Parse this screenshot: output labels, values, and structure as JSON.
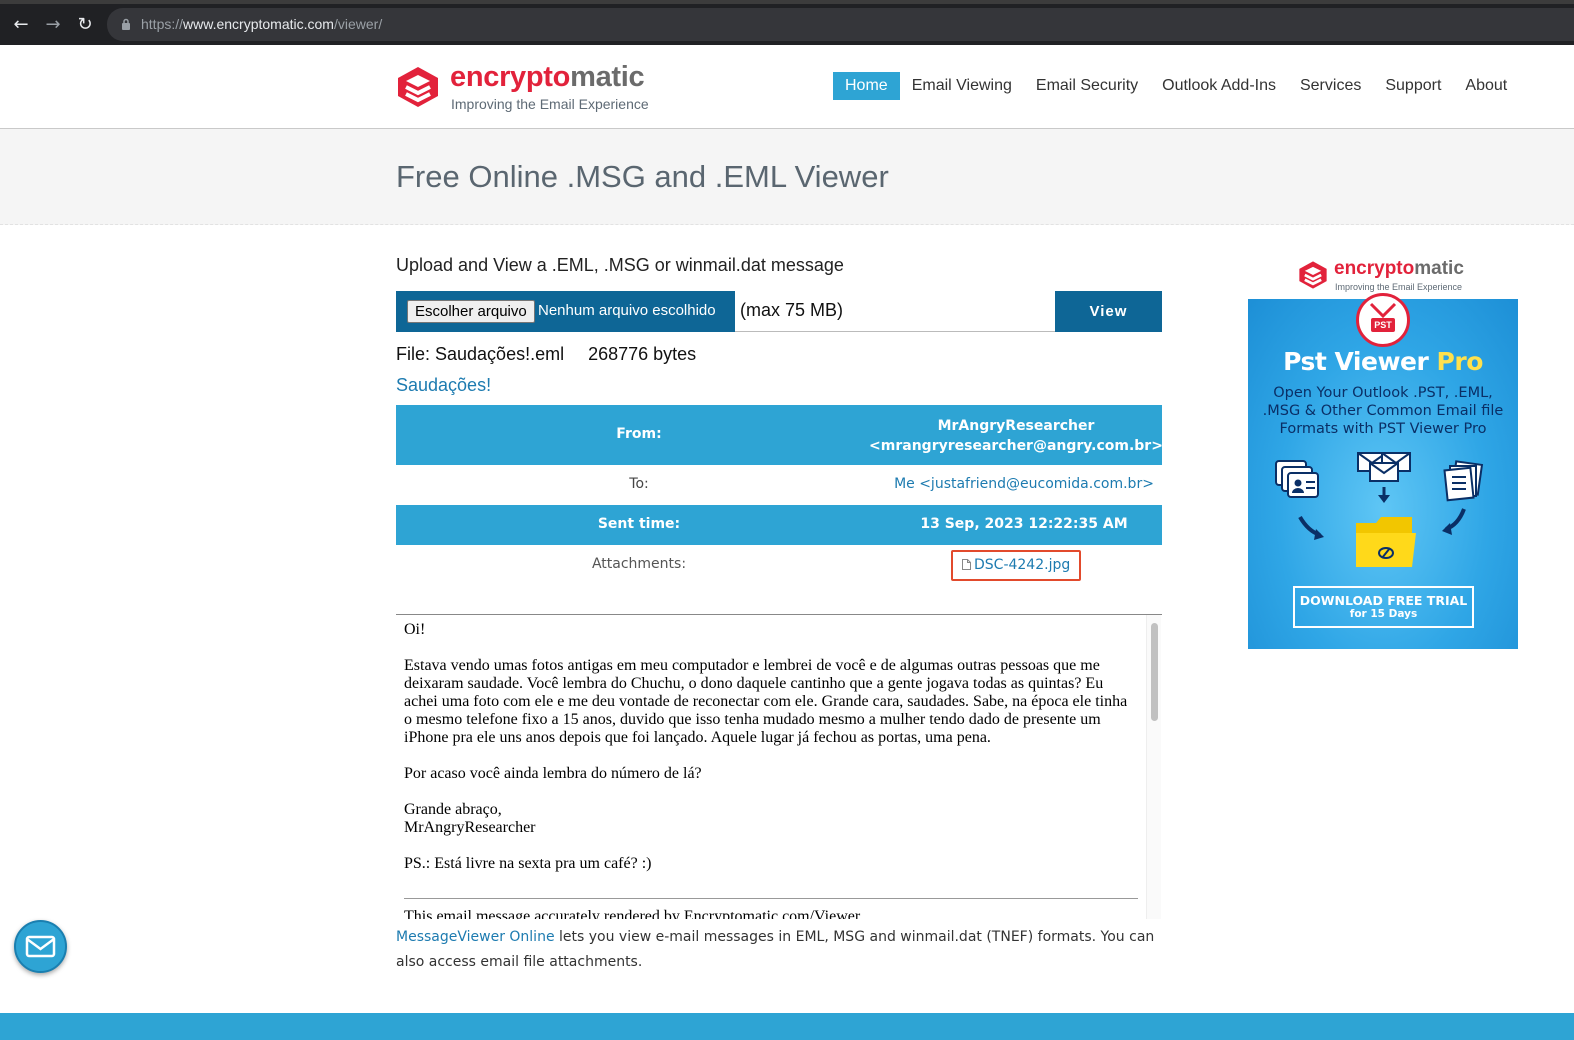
{
  "browser": {
    "url_scheme": "https://",
    "url_host": "www.encryptomatic.com",
    "url_path": "/viewer/",
    "back_icon": "back-arrow-icon",
    "forward_icon": "forward-arrow-icon",
    "reload_icon": "reload-icon",
    "lock_icon": "lock-icon"
  },
  "brand": {
    "name_red": "encrypto",
    "name_gray": "matic",
    "tagline": "Improving the Email Experience",
    "red": "#e2223b",
    "accent": "#2ea4d4",
    "dark_blue": "#0e6696"
  },
  "nav": {
    "items": [
      {
        "label": "Home",
        "active": true
      },
      {
        "label": "Email Viewing",
        "active": false
      },
      {
        "label": "Email Security",
        "active": false
      },
      {
        "label": "Outlook Add-Ins",
        "active": false
      },
      {
        "label": "Services",
        "active": false
      },
      {
        "label": "Support",
        "active": false
      },
      {
        "label": "About",
        "active": false
      }
    ]
  },
  "page": {
    "title": "Free Online .MSG and .EML Viewer"
  },
  "upload": {
    "heading": "Upload and View a .EML, .MSG or winmail.dat message",
    "choose_label": "Escolher arquivo",
    "no_file_label": "Nenhum arquivo escolhido",
    "max_size": "(max 75 MB)",
    "view_label": "View"
  },
  "file": {
    "name": "File: Saudações!.eml",
    "size": "268776 bytes"
  },
  "message": {
    "subject": "Saudações!",
    "from_label": "From:",
    "from_name": "MrAngryResearcher",
    "from_email": "<mrangryresearcher@angry.com.br>",
    "to_label": "To:",
    "to_value": "Me <justafriend@eucomida.com.br>",
    "sent_label": "Sent time:",
    "sent_value": "13 Sep, 2023 12:22:35 AM",
    "attachments_label": "Attachments:",
    "attachment_name": "DSC-4242.jpg",
    "attachment_icon": "file-icon",
    "body": {
      "greeting": "Oi!",
      "paragraph1": "Estava vendo umas fotos antigas em meu computador e lembrei de você e de algumas outras pessoas que me deixaram saudade. Você lembra do Chuchu, o dono daquele cantinho que a gente jogava todas as quintas? Eu achei uma foto com ele e me deu vontade de reconectar com ele. Grande cara, saudades. Sabe, na época ele tinha o mesmo telefone fixo a 15 anos, duvido que isso tenha mudado mesmo a mulher tendo dado de presente um iPhone pra ele uns anos depois que foi lançado. Aquele lugar já fechou as portas, uma pena.",
      "paragraph2": "Por acaso você ainda lembra do número de lá?",
      "closing": "Grande abraço,",
      "signature": "MrAngryResearcher",
      "ps": "PS.: Está livre na sexta pra um café? :)",
      "footer": "This email message accurately rendered by Encryptomatic.com/Viewer"
    }
  },
  "about": {
    "link_text": "MessageViewer Online",
    "text": " lets you view e-mail messages in EML, MSG and winmail.dat (TNEF) formats. You can also access email file attachments."
  },
  "ad": {
    "brand_red": "encrypto",
    "brand_gray": "matic",
    "tagline": "Improving the Email Experience",
    "badge": "PST",
    "title_main": "Pst Viewer ",
    "title_pro": "Pro",
    "subtitle": "Open Your Outlook .PST, .EML, .MSG & Other Common Email file Formats with PST Viewer Pro",
    "cta_line1": "DOWNLOAD FREE TRIAL",
    "cta_line2": "for 15 Days"
  },
  "chat": {
    "icon": "envelope-icon"
  }
}
